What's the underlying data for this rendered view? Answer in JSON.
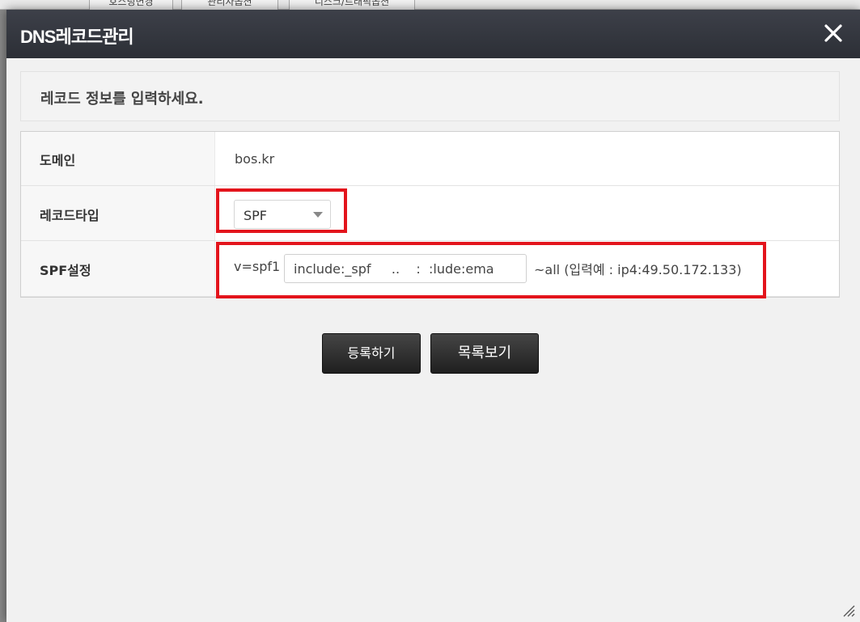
{
  "background": {
    "tabs": [
      "호스팅변경",
      "관리자옵션",
      "디스크/트래픽옵션"
    ]
  },
  "modal": {
    "title": "DNS레코드관리",
    "notice": "레코드 정보를 입력하세요.",
    "rows": {
      "domain": {
        "label": "도메인",
        "value": "bos.kr"
      },
      "record_type": {
        "label": "레코드타입",
        "selected": "SPF"
      },
      "spf": {
        "label": "SPF설정",
        "prefix": "v=spf1",
        "input_value": "include:_spf     ..    :  :lude:ema",
        "suffix": "~all (입력예 : ip4:49.50.172.133)"
      }
    },
    "buttons": {
      "register": "등록하기",
      "list": "목록보기"
    }
  },
  "icons": {
    "close": "close-icon",
    "dropdown": "triangle-down-icon",
    "resize": "resize-grip-icon"
  },
  "colors": {
    "header": "#2f323a",
    "highlight": "#e3141c",
    "button": "#2a2a2a"
  }
}
